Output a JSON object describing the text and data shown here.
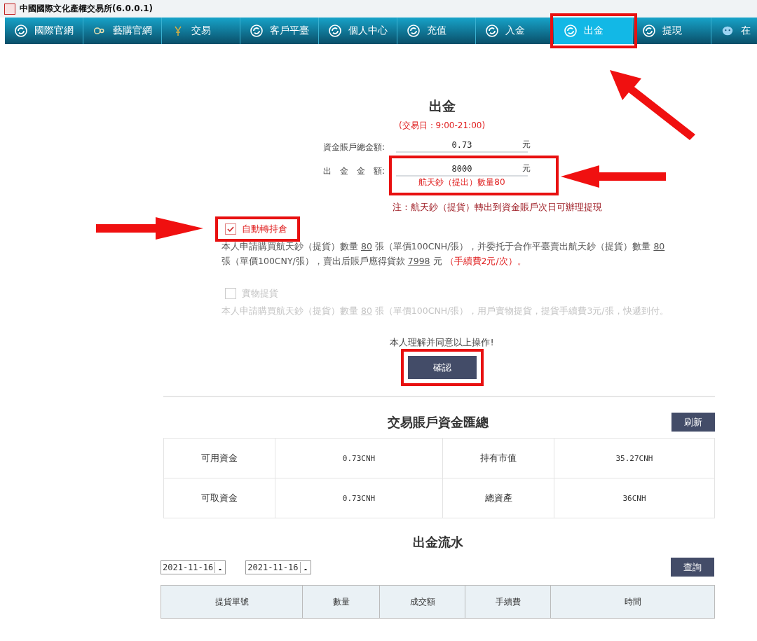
{
  "window": {
    "title": "中國國際文化產權交易所(6.0.0.1)"
  },
  "tabs": [
    {
      "label": "國際官網",
      "kind": "cycle",
      "selected": false,
      "highlighted": false
    },
    {
      "label": "藝購官網",
      "kind": "link",
      "selected": false,
      "highlighted": false
    },
    {
      "label": "交易",
      "kind": "yen",
      "selected": false,
      "highlighted": false
    },
    {
      "label": "客戶平臺",
      "kind": "cycle",
      "selected": false,
      "highlighted": false
    },
    {
      "label": "個人中心",
      "kind": "cycle",
      "selected": false,
      "highlighted": false
    },
    {
      "label": "充值",
      "kind": "cycle",
      "selected": false,
      "highlighted": false
    },
    {
      "label": "入金",
      "kind": "cycle",
      "selected": false,
      "highlighted": false
    },
    {
      "label": "出金",
      "kind": "cycle",
      "selected": true,
      "highlighted": true
    },
    {
      "label": "提現",
      "kind": "cycle",
      "selected": false,
      "highlighted": false
    },
    {
      "label": "在",
      "kind": "face",
      "selected": false,
      "highlighted": false
    }
  ],
  "withdraw": {
    "title": "出金",
    "hours": "(交易日：9:00-21:00)",
    "fields": [
      {
        "label": "資金賬戶總金額:",
        "value": "0.73",
        "unit": "元",
        "highlighted": false
      },
      {
        "label": "出　金　金　額:",
        "value": "8000",
        "unit": "元",
        "hint": "航天鈔（提出）數量80",
        "highlighted": true
      }
    ],
    "note": "注：航天鈔（提貨）轉出到資金賬戶次日可辦理提現",
    "options": [
      {
        "label": "自動轉持倉",
        "checked": true,
        "disabled": false,
        "highlighted": true,
        "text": [
          {
            "kind": "plain",
            "t": "本人申請購買航天鈔（提貨）數量 "
          },
          {
            "kind": "underline",
            "t": "80"
          },
          {
            "kind": "plain",
            "t": " 張（單價100CNH/張），并委托于合作平臺賣出航天鈔（提貨）數量 "
          },
          {
            "kind": "underline",
            "t": "80"
          },
          {
            "kind": "plain",
            "t": " 張（單價100CNY/張），賣出后賬戶應得貨款 "
          },
          {
            "kind": "underline",
            "t": "7998"
          },
          {
            "kind": "plain",
            "t": " 元 "
          },
          {
            "kind": "fee",
            "t": "（手續費2元/次）。"
          }
        ]
      },
      {
        "label": "實物提貨",
        "checked": false,
        "disabled": true,
        "highlighted": false,
        "text": [
          {
            "kind": "plain",
            "t": "本人申請購買航天鈔（提貨）數量 "
          },
          {
            "kind": "underline",
            "t": "80"
          },
          {
            "kind": "plain",
            "t": " 張（單價100CNH/張），用戶實物提貨，提貨手續費3元/張，快遞到付。"
          }
        ]
      }
    ],
    "agree": "本人理解并同意以上操作!",
    "confirm": {
      "label": "確認",
      "highlighted": true
    }
  },
  "summary": {
    "title": "交易賬戶資金匯總",
    "refresh": "刷新",
    "rows": [
      [
        "可用資金",
        "0.73CNH",
        "持有市值",
        "35.27CNH"
      ],
      [
        "可取資金",
        "0.73CNH",
        "總資產",
        "36CNH"
      ]
    ]
  },
  "history": {
    "title": "出金流水",
    "from": "2021-11-16",
    "to": "2021-11-16",
    "query": "查詢",
    "columns": [
      "提貨單號",
      "數量",
      "成交額",
      "手續費",
      "時間"
    ]
  }
}
